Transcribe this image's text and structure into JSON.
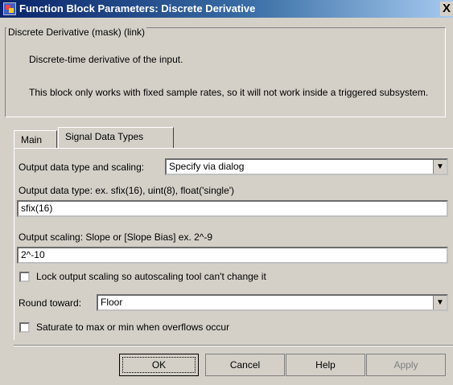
{
  "window": {
    "title": "Function Block Parameters: Discrete Derivative",
    "close_label": "X"
  },
  "mask": {
    "legend": "Discrete Derivative (mask) (link)",
    "description_line1": "Discrete-time derivative of the input.",
    "description_line2": "This block only works with fixed sample rates, so it will not work inside a triggered subsystem."
  },
  "tabs": [
    {
      "label": "Main",
      "active": false
    },
    {
      "label": "Signal Data Types",
      "active": true
    }
  ],
  "params": {
    "output_dtype_scaling_label": "Output data type and scaling:",
    "output_dtype_scaling_value": "Specify via dialog",
    "output_dtype_label": "Output data type:   ex.  sfix(16),  uint(8),  float('single')",
    "output_dtype_value": "sfix(16)",
    "output_scaling_label": "Output scaling:   Slope or [Slope Bias]   ex.  2^-9",
    "output_scaling_value": "2^-10",
    "lock_scaling_label": "Lock output scaling so autoscaling tool can't change it",
    "lock_scaling_checked": false,
    "round_toward_label": "Round toward:",
    "round_toward_value": "Floor",
    "saturate_label": "Saturate to max or min when overflows occur",
    "saturate_checked": false
  },
  "buttons": {
    "ok": "OK",
    "cancel": "Cancel",
    "help": "Help",
    "apply": "Apply"
  }
}
